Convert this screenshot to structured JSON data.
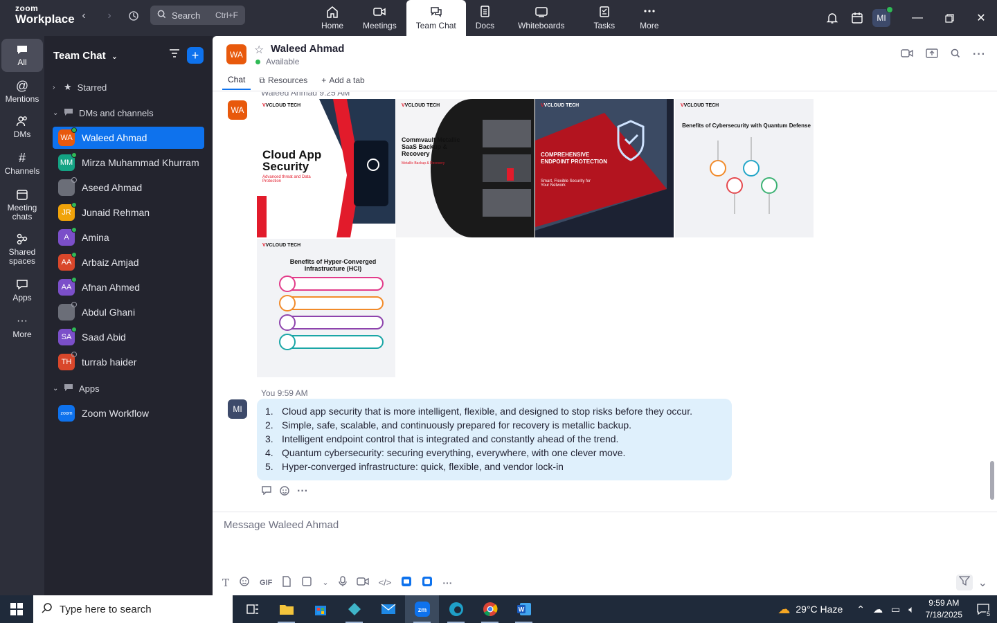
{
  "app": {
    "logo_top": "zoom",
    "logo_bottom": "Workplace"
  },
  "search": {
    "label": "Search",
    "shortcut": "Ctrl+F"
  },
  "tabs": [
    {
      "label": "Home",
      "icon": "home-icon"
    },
    {
      "label": "Meetings",
      "icon": "video-icon"
    },
    {
      "label": "Team Chat",
      "icon": "chat-icon"
    },
    {
      "label": "Docs",
      "icon": "doc-icon"
    },
    {
      "label": "Whiteboards",
      "icon": "whiteboard-icon"
    },
    {
      "label": "Tasks",
      "icon": "tasks-icon"
    },
    {
      "label": "More",
      "icon": "more-icon"
    }
  ],
  "active_tab": "Team Chat",
  "user": {
    "initials": "MI"
  },
  "rail": [
    {
      "label": "All"
    },
    {
      "label": "Mentions"
    },
    {
      "label": "DMs"
    },
    {
      "label": "Channels"
    },
    {
      "label": "Meeting chats"
    },
    {
      "label": "Shared spaces"
    },
    {
      "label": "Apps"
    },
    {
      "label": "More"
    }
  ],
  "sidebar": {
    "title": "Team Chat",
    "starred": "Starred",
    "dms_section": "DMs and channels",
    "apps_section": "Apps",
    "contacts": [
      {
        "name": "Waleed Ahmad",
        "initials": "WA",
        "color": "#e8590c"
      },
      {
        "name": "Mirza Muhammad Khurram",
        "initials": "MM",
        "color": "#14a384"
      },
      {
        "name": "Aseed Ahmad",
        "initials": "",
        "color": "#6b6e78"
      },
      {
        "name": "Junaid Rehman",
        "initials": "JR",
        "color": "#f0a30a"
      },
      {
        "name": "Amina",
        "initials": "A",
        "color": "#7b4fc9"
      },
      {
        "name": "Arbaiz Amjad",
        "initials": "AA",
        "color": "#d9472b"
      },
      {
        "name": "Afnan Ahmed",
        "initials": "AA",
        "color": "#7b4fc9"
      },
      {
        "name": "Abdul Ghani",
        "initials": "",
        "color": "#6b6e78"
      },
      {
        "name": "Saad Abid",
        "initials": "SA",
        "color": "#7b4fc9"
      },
      {
        "name": "turrab haider",
        "initials": "TH",
        "color": "#d9472b"
      }
    ],
    "apps": [
      {
        "name": "Zoom Workflow",
        "initials": "zoom",
        "color": "#0e72ed"
      }
    ]
  },
  "chat": {
    "name": "Waleed Ahmad",
    "initials": "WA",
    "status": "Available",
    "tabs": [
      "Chat",
      "Resources",
      "Add a tab"
    ],
    "prev_sender": "Waleed Ahmad 9:25 AM",
    "images": [
      {
        "brand": "VCLOUD TECH",
        "title": "Cloud App Security",
        "subtitle": "Advanced threat and Data Protection"
      },
      {
        "brand": "VCLOUD TECH",
        "title": "Commvault Metallic SaaS Backup & Recovery",
        "subtitle": "Metallic Backup & Recovery"
      },
      {
        "brand": "VCLOUD TECH",
        "title": "COMPREHENSIVE ENDPOINT PROTECTION",
        "subtitle": "Smart, Flexible Security for Your Network"
      },
      {
        "brand": "VCLOUD TECH",
        "title": "Benefits of Cybersecurity with Quantum Defense",
        "subtitle": ""
      },
      {
        "brand": "VCLOUD TECH",
        "title": "Benefits of Hyper-Converged Infrastructure (HCI)",
        "subtitle": ""
      }
    ],
    "my_message": {
      "sender": "You 9:59 AM",
      "items": [
        "Cloud app security that is more intelligent, flexible, and designed to stop risks before they occur.",
        "Simple, safe, scalable, and continuously prepared for recovery is metallic backup.",
        "Intelligent endpoint control that is integrated and constantly ahead of the trend.",
        "Quantum cybersecurity: securing everything, everywhere, with one clever move.",
        "Hyper-converged infrastructure: quick, flexible, and vendor lock-in"
      ]
    },
    "composer_placeholder": "Message Waleed Ahmad"
  },
  "taskbar": {
    "search_placeholder": "Type here to search",
    "weather": "29°C  Haze",
    "time": "9:59 AM",
    "date": "7/18/2025",
    "notifications": "5"
  }
}
